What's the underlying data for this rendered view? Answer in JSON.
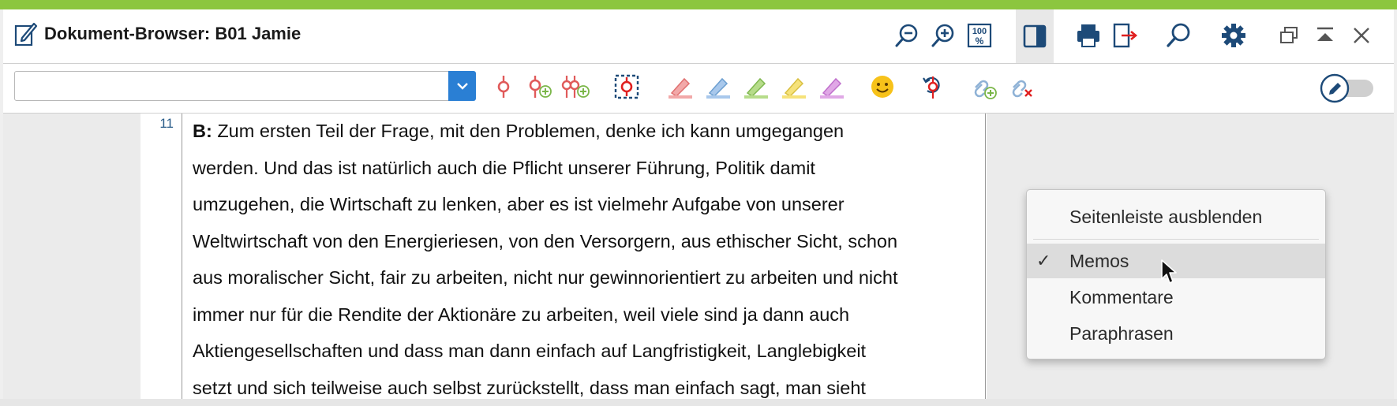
{
  "window": {
    "title": "Dokument-Browser: B01 Jamie",
    "accent_color": "#8cc63f",
    "title_buttons": [
      "zoom-out-icon",
      "zoom-in-icon",
      "zoom-100-icon",
      "sidebar-toggle-icon",
      "printer-icon",
      "export-icon",
      "search-icon",
      "settings-gear-icon",
      "restore-window-icon",
      "collapse-window-icon",
      "close-icon"
    ]
  },
  "toolbar": {
    "code_combo_value": "",
    "tools": [
      "code-icon",
      "code-new-icon",
      "code-recent-icon",
      "select-region-icon",
      "highlight-red-icon",
      "highlight-blue-icon",
      "highlight-green-icon",
      "highlight-yellow-icon",
      "highlight-purple-icon",
      "emoticode-icon",
      "undo-code-icon",
      "link-add-icon",
      "link-remove-icon"
    ],
    "edit_mode_on": false
  },
  "document": {
    "paragraph_number": "11",
    "speaker": "B:",
    "lines": [
      " Zum ersten Teil der Frage, mit den Problemen, denke ich kann umgegangen",
      "werden. Und das ist natürlich auch die Pflicht unserer Führung, Politik damit",
      "umzugehen, die Wirtschaft zu lenken, aber es ist vielmehr Aufgabe von unserer",
      "Weltwirtschaft von den Energieriesen, von den Versorgern, aus ethischer Sicht, schon",
      "aus moralischer Sicht, fair zu arbeiten, nicht nur gewinnorientiert zu arbeiten und nicht",
      "immer nur für die Rendite der Aktionäre zu arbeiten, weil viele sind ja dann auch",
      "Aktiengesellschaften und dass man dann einfach auf Langfristigkeit, Langlebigkeit",
      "setzt und sich teilweise auch selbst zurückstellt, dass man einfach sagt, man sieht"
    ]
  },
  "context_menu": {
    "hide_sidebar": "Seitenleiste ausblenden",
    "items": [
      {
        "label": "Memos",
        "checked": true
      },
      {
        "label": "Kommentare",
        "checked": false
      },
      {
        "label": "Paraphrasen",
        "checked": false
      }
    ],
    "check_mark": "✓"
  }
}
